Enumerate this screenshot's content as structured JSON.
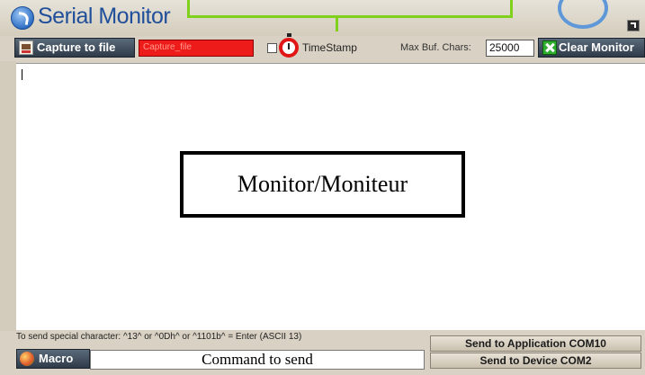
{
  "window": {
    "title": "Serial Monitor"
  },
  "toolbar": {
    "capture_label": "Capture to file",
    "capture_file_value": "Capture_file",
    "timestamp_checked": false,
    "timestamp_label": "TimeStamp",
    "max_buf_label": "Max Buf. Chars:",
    "max_buf_value": "25000",
    "clear_label": "Clear Monitor"
  },
  "monitor": {
    "overlay_label": "Monitor/Moniteur"
  },
  "bottom": {
    "hint": "To send special character:  ^13^ or ^0Dh^ or ^1101b^ = Enter (ASCII 13)",
    "macro_label": "Macro",
    "command_label": "Command to send",
    "send_app_label": "Send to Application COM10",
    "send_device_label": "Send to Device COM2"
  },
  "icons": {
    "app": "serial-monitor-app-icon",
    "capture": "save-to-file-icon",
    "timer": "stopwatch-icon",
    "clear": "clear-x-icon",
    "macro": "macro-icon",
    "restore": "restore-window-icon"
  },
  "colors": {
    "file_field_bg": "#ee1b1b",
    "accent_green": "#7fd11c",
    "title_blue": "#1f4f9a"
  }
}
